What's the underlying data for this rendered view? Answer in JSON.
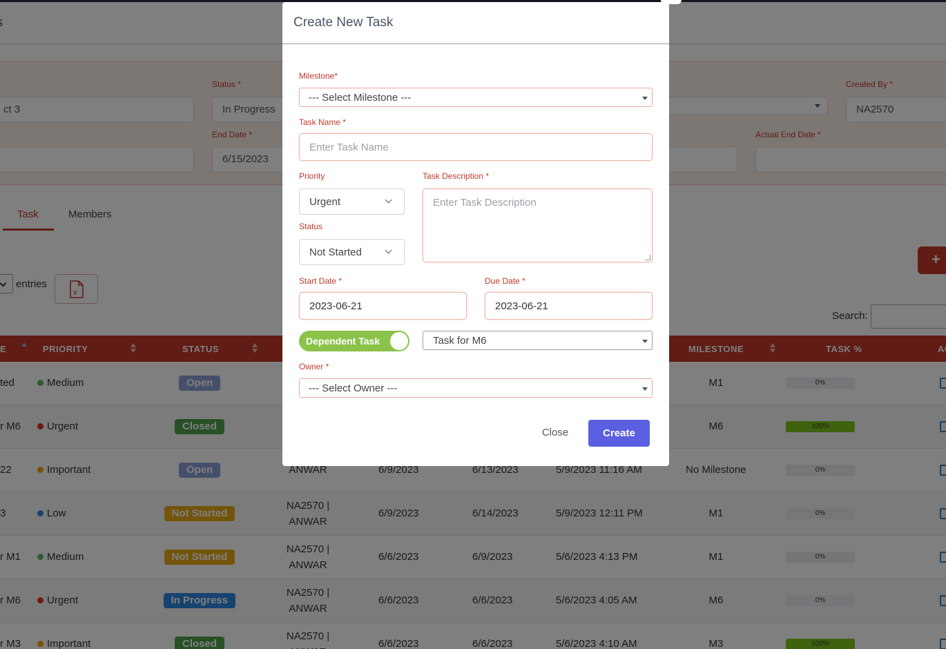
{
  "page": {
    "title_fragment": "ts",
    "project": {
      "name_label": "",
      "name_value": "ct 3",
      "status_label": "Status",
      "status_value": "In Progress",
      "end_date_label": "End Date",
      "end_date_value": "6/15/2023",
      "created_by_label": "Created By",
      "created_by_value": "NA2570",
      "actual_end_label": "Actual End Date",
      "required_mark": "*"
    },
    "tabs": [
      {
        "label": "Task"
      },
      {
        "label": "Members"
      }
    ],
    "entries_label": "entries",
    "search_label": "Search:",
    "add_icon": "+",
    "excel_icon": "excel-file-icon"
  },
  "table": {
    "headers": {
      "priority": "PRIORITY",
      "status": "STATUS",
      "milestone": "MILESTONE",
      "task_pct": "TASK %",
      "actions": "AC"
    },
    "rows": [
      {
        "name": "ted",
        "priority": "Medium",
        "priority_color": "#5cb85c",
        "status": "Open",
        "status_color": "#8b9fd6",
        "owner_1": "",
        "owner_2": "",
        "start": "",
        "due": "",
        "created": "",
        "milestone": "M1",
        "pct_text": "0%",
        "pct": 0
      },
      {
        "name": "r M6",
        "priority": "Urgent",
        "priority_color": "#d9301c",
        "status": "Closed",
        "status_color": "#4fa34a",
        "owner_1": "",
        "owner_2": "",
        "start": "",
        "due": "",
        "created": "",
        "milestone": "M6",
        "pct_text": "100%",
        "pct": 100
      },
      {
        "name": "22",
        "priority": "Important",
        "priority_color": "#f0a500",
        "status": "Open",
        "status_color": "#8b9fd6",
        "owner_1": "",
        "owner_2": "ANWAR",
        "start": "6/9/2023",
        "due": "6/13/2023",
        "created": "5/9/2023 11:16 AM",
        "milestone": "No Milestone",
        "pct_text": "0%",
        "pct": 0
      },
      {
        "name": "3",
        "priority": "Low",
        "priority_color": "#2e86de",
        "status": "Not Started",
        "status_color": "#e6a817",
        "owner_1": "NA2570 |",
        "owner_2": "ANWAR",
        "start": "6/9/2023",
        "due": "6/14/2023",
        "created": "5/9/2023 12:11 PM",
        "milestone": "M1",
        "pct_text": "0%",
        "pct": 0
      },
      {
        "name": "r M1",
        "priority": "Medium",
        "priority_color": "#5cb85c",
        "status": "Not Started",
        "status_color": "#e6a817",
        "owner_1": "NA2570 |",
        "owner_2": "ANWAR",
        "start": "6/6/2023",
        "due": "6/9/2023",
        "created": "5/6/2023 4:13 PM",
        "milestone": "M1",
        "pct_text": "0%",
        "pct": 0
      },
      {
        "name": "r M6",
        "priority": "Urgent",
        "priority_color": "#d9301c",
        "status": "In Progress",
        "status_color": "#2e86de",
        "owner_1": "NA2570 |",
        "owner_2": "ANWAR",
        "start": "6/6/2023",
        "due": "6/6/2023",
        "created": "5/6/2023 4:05 AM",
        "milestone": "M6",
        "pct_text": "0%",
        "pct": 0
      },
      {
        "name": "r M3",
        "priority": "Important",
        "priority_color": "#f0a500",
        "status": "Closed",
        "status_color": "#4fa34a",
        "owner_1": "NA2570 |",
        "owner_2": "ANWAR",
        "start": "6/6/2023",
        "due": "6/6/2023",
        "created": "5/6/2023 4:10 AM",
        "milestone": "M3",
        "pct_text": "100%",
        "pct": 100
      }
    ]
  },
  "modal": {
    "title": "Create New Task",
    "milestone_label": "Milestone*",
    "milestone_value": "--- Select Milestone ---",
    "task_name_label": "Task Name *",
    "task_name_placeholder": "Enter Task Name",
    "priority_label": "Priority",
    "priority_value": "Urgent",
    "status_label": "Status",
    "status_value": "Not Started",
    "description_label": "Task Description *",
    "description_placeholder": "Enter Task Description",
    "start_date_label": "Start Date *",
    "start_date_value": "2023-06-21",
    "due_date_label": "Due Date *",
    "due_date_value": "2023-06-21",
    "dependent_toggle_label": "Dependent Task",
    "dependent_toggle_on": true,
    "dependent_task_value": "Task for M6",
    "owner_label": "Owner *",
    "owner_value": "--- Select Owner ---",
    "close_label": "Close",
    "create_label": "Create"
  },
  "colors": {
    "accent": "#c0392b",
    "primary_button": "#5a5fe0",
    "toggle_on": "#8bc34a",
    "progress_fill": "#7fc41c"
  }
}
